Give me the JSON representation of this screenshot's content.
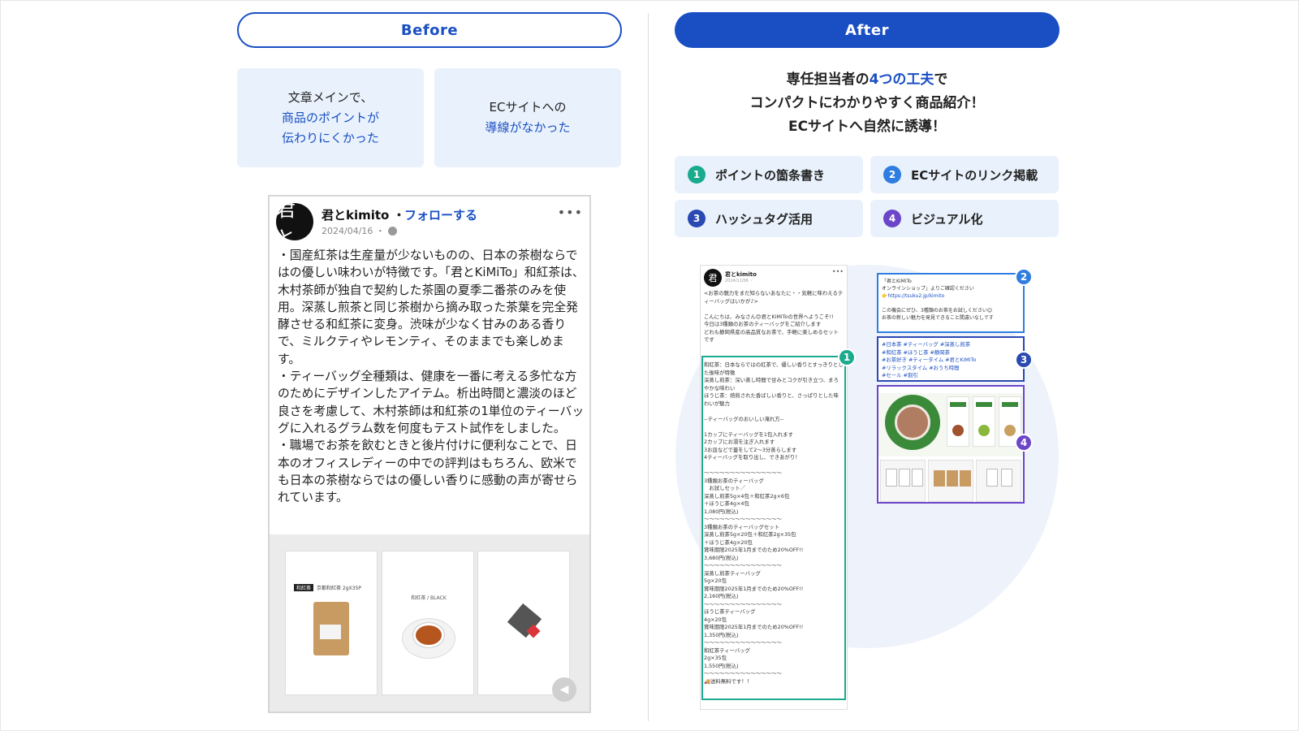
{
  "before": {
    "label": "Before",
    "problems": [
      {
        "line1": "文章メインで、",
        "line2": "商品のポイントが",
        "line3": "伝わりにくかった"
      },
      {
        "line1": "ECサイトへの",
        "line2": "導線がなかった"
      }
    ],
    "post": {
      "avatar_char": "君と",
      "name": "君とkimito",
      "separator": "・",
      "follow": "フォローする",
      "date": "2024/04/16 ・",
      "more": "•••",
      "body": "・国産紅茶は生産量が少ないものの、日本の茶樹ならではの優しい味わいが特徴です。「君とKiMiTo」和紅茶は、木村茶師が独自で契約した茶園の夏季二番茶のみを使用。深蒸し煎茶と同じ茶樹から摘み取った茶葉を完全発酵させる和紅茶に変身。渋味が少なく甘みのある香りで、ミルクティやレモンティ、そのままでも楽しめます。\n・ティーバッグ全種類は、健康を一番に考える多忙な方のためにデザインしたアイテム。析出時間と濃淡のほど良さを考慮して、木村茶師は和紅茶の1単位のティーバッグに入れるグラム数を何度もテスト試作をしました。\n・職場でお茶を飲むときと後片付けに便利なことで、日本のオフィスレディーの中での評判はもちろん、欧米でも日本の茶樹ならではの優しい香りに感動の声が寄せられています。",
      "gallery": [
        {
          "tag": "和紅茶",
          "label": "京都和紅茶 2gX35P"
        },
        {
          "label": "和紅茶 / BLACK"
        },
        {
          "label": ""
        }
      ]
    }
  },
  "after": {
    "label": "After",
    "headline": {
      "line1_pre": "専任担当者の",
      "line1_em": "4つの工夫",
      "line1_post": "で",
      "line2": "コンパクトにわかりやすく商品紹介！",
      "line3": "ECサイトへ自然に誘導！"
    },
    "points": [
      {
        "num": "1",
        "label": "ポイントの箇条書き",
        "color": "#1aaa8e"
      },
      {
        "num": "2",
        "label": "ECサイトのリンク掲載",
        "color": "#2f7de0"
      },
      {
        "num": "3",
        "label": "ハッシュタグ活用",
        "color": "#2a49b2"
      },
      {
        "num": "4",
        "label": "ビジュアル化",
        "color": "#6b46c9"
      }
    ],
    "mini_post": {
      "avatar_char": "君",
      "name": "君とkimito",
      "date": "2024/11/06 ・",
      "more": "•••",
      "intro": "<お茶の魅力をまだ知らないあなたに・・気軽に味わえるティーバッグはいかが♪>\n\nこんにちは、みなさん😊君とKiMiToの世界へようこそ!!\n今日は3種類のお茶のティーバッグをご紹介します\nどれも静岡県産の高品質なお茶で、手軽に楽しめるセットです",
      "list": "和紅茶：日本ならではの紅茶で、優しい香りとすっきりとした後味が特徴\n深蒸し煎茶：深い蒸し時間で甘みとコクが引き立つ、まろやかな味わい\nほうじ茶：焙煎された香ばしい香りと、さっぱりとした味わいが魅力\n\n--ティーバッグのおいしい淹れ方--\n\n1カップにティーバッグを1包入れます\n2カップにお湯を注ぎ入れます\n3お皿などで蓋をして2〜3分蒸らします\n4ティーバッグを取り出し、できあがり！\n\n〜〜〜〜〜〜〜〜〜〜〜〜〜〜〜\n3種類お茶のティーバッグ\n　お試しセット／\n深蒸し煎茶5g×4包＋和紅茶2g×6包\n＋ほうじ茶4g×4包\n1,080円(税込)\n〜〜〜〜〜〜〜〜〜〜〜〜〜〜〜\n3種類お茶のティーバッグセット\n深蒸し煎茶5g×20包＋和紅茶2g×35包\n＋ほうじ茶4g×20包\n賞味期限2025年1月までのため20%OFF!!\n3,680円(税込)\n〜〜〜〜〜〜〜〜〜〜〜〜〜〜〜\n深蒸し煎茶ティーバッグ\n5g×20包\n賞味期限2025年1月までのため20%OFF!!\n2,160円(税込)\n〜〜〜〜〜〜〜〜〜〜〜〜〜〜〜\nほうじ茶ティーバッグ\n4g×20包\n賞味期限2025年1月までのため20%OFF!!\n1,350円(税込)\n〜〜〜〜〜〜〜〜〜〜〜〜〜〜〜\n和紅茶ティーバッグ\n2g×35包\n1,550円(税込)\n〜〜〜〜〜〜〜〜〜〜〜〜〜〜〜\n🚚送料無料です！！"
    },
    "card2": {
      "line1": "「君とKiMiTo",
      "line2": "オンラインショップ」よりご確認ください",
      "link": "👉https://tsuku2.jp/kimito",
      "line3": "この機会にぜひ、3種類のお茶をお試しください😊\nお茶の新しい魅力を発見できること間違いなしです"
    },
    "card3": {
      "tags": "#日本茶 #ティーバッグ #深蒸し煎茶\n#和紅茶 #ほうじ茶 #静岡茶\n#お茶好き #ティータイム #君とKiMiTo\n#リラックスタイム #おうち時間\n#セール #割引"
    }
  }
}
